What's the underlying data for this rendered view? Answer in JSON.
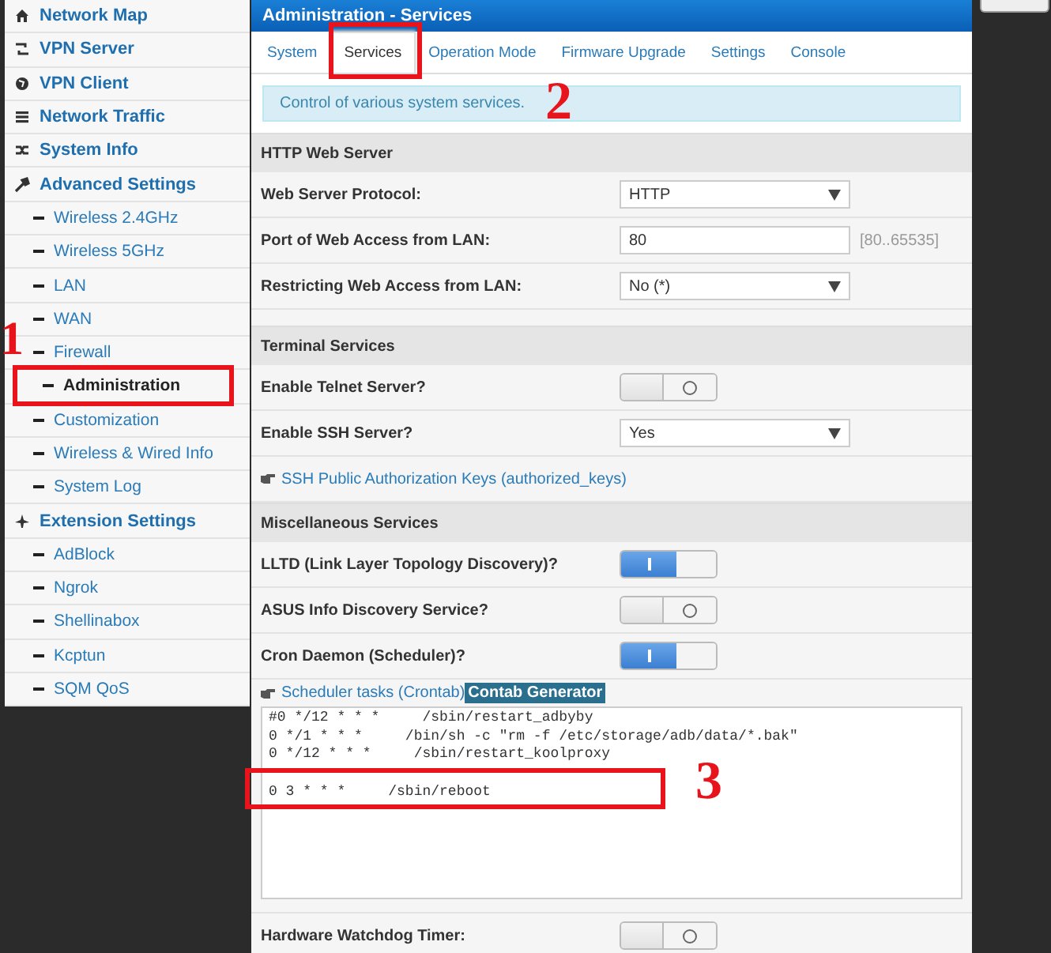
{
  "sidebar": {
    "items": [
      {
        "kind": "group",
        "label": "Network Map",
        "selected": false
      },
      {
        "kind": "group",
        "label": "VPN Server",
        "selected": false
      },
      {
        "kind": "group",
        "label": "VPN Client",
        "selected": false
      },
      {
        "kind": "group",
        "label": "Network Traffic",
        "selected": false
      },
      {
        "kind": "group",
        "label": "System Info",
        "selected": false
      },
      {
        "kind": "group",
        "label": "Advanced Settings",
        "selected": false
      },
      {
        "kind": "sub",
        "label": "Wireless 2.4GHz",
        "selected": false
      },
      {
        "kind": "sub",
        "label": "Wireless 5GHz",
        "selected": false
      },
      {
        "kind": "sub",
        "label": "LAN",
        "selected": false
      },
      {
        "kind": "sub",
        "label": "WAN",
        "selected": false
      },
      {
        "kind": "sub",
        "label": "Firewall",
        "selected": false
      },
      {
        "kind": "sub",
        "label": "Administration",
        "selected": true
      },
      {
        "kind": "sub",
        "label": "Customization",
        "selected": false
      },
      {
        "kind": "sub",
        "label": "Wireless & Wired Info",
        "selected": false
      },
      {
        "kind": "sub",
        "label": "System Log",
        "selected": false
      },
      {
        "kind": "group",
        "label": "Extension Settings",
        "selected": false
      },
      {
        "kind": "sub",
        "label": "AdBlock",
        "selected": false
      },
      {
        "kind": "sub",
        "label": "Ngrok",
        "selected": false
      },
      {
        "kind": "sub",
        "label": "Shellinabox",
        "selected": false
      },
      {
        "kind": "sub",
        "label": "Kcptun",
        "selected": false
      },
      {
        "kind": "sub",
        "label": "SQM QoS",
        "selected": false
      }
    ]
  },
  "panel": {
    "title": "Administration - Services",
    "tabs": [
      {
        "label": "System",
        "selected": false
      },
      {
        "label": "Services",
        "selected": true
      },
      {
        "label": "Operation Mode",
        "selected": false
      },
      {
        "label": "Firmware Upgrade",
        "selected": false
      },
      {
        "label": "Settings",
        "selected": false
      },
      {
        "label": "Console",
        "selected": false
      }
    ],
    "info": "Control of various system services.",
    "sections": [
      {
        "title": "HTTP Web Server",
        "rows": [
          {
            "kind": "select",
            "label": "Web Server Protocol:",
            "value": "HTTP"
          },
          {
            "kind": "input",
            "label": "Port of Web Access from LAN:",
            "value": "80",
            "hint": "[80..65535]"
          },
          {
            "kind": "select",
            "label": "Restricting Web Access from LAN:",
            "value": "No (*)"
          }
        ]
      },
      {
        "title": "Terminal Services",
        "rows": [
          {
            "kind": "toggle",
            "label": "Enable Telnet Server?",
            "on": false
          },
          {
            "kind": "select",
            "label": "Enable SSH Server?",
            "value": "Yes"
          },
          {
            "kind": "link",
            "label": "SSH Public Authorization Keys (authorized_keys)"
          }
        ]
      },
      {
        "title": "Miscellaneous Services",
        "rows": [
          {
            "kind": "toggle",
            "label": "LLTD (Link Layer Topology Discovery)?",
            "on": true
          },
          {
            "kind": "toggle",
            "label": "ASUS Info Discovery Service?",
            "on": false
          },
          {
            "kind": "toggle",
            "label": "Cron Daemon (Scheduler)?",
            "on": true
          },
          {
            "kind": "crontab",
            "label": "Scheduler tasks (Crontab)",
            "button": "Contab Generator",
            "lines": [
              "#0 */12 * * *     /sbin/restart_adbyby",
              "0 */1 * * *     /bin/sh -c \"rm -f /etc/storage/adb/data/*.bak\"",
              "0 */12 * * *     /sbin/restart_koolproxy",
              "0 3 * * *     /sbin/reboot"
            ]
          },
          {
            "kind": "toggle",
            "label": "Hardware Watchdog Timer:",
            "on": false
          }
        ]
      }
    ]
  },
  "annotations": [
    {
      "label": "1"
    },
    {
      "label": "2"
    },
    {
      "label": "3"
    }
  ]
}
